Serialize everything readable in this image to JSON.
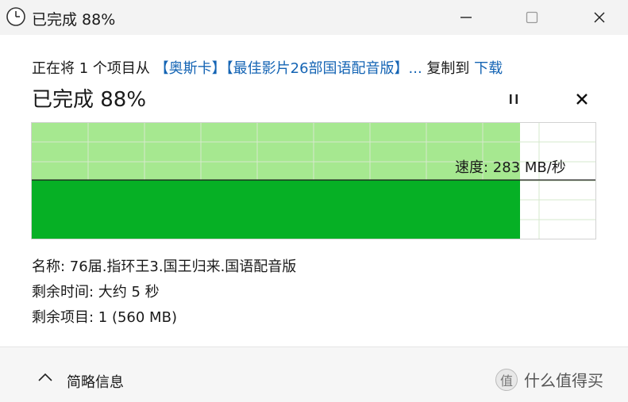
{
  "window": {
    "title": "已完成 88%",
    "icons": {
      "app": "clock-icon",
      "minimize": "minimize-icon",
      "maximize": "maximize-icon",
      "close": "close-icon"
    }
  },
  "transfer": {
    "prefix": "正在将 1 个项目从 ",
    "source": "【奥斯卡】【最佳影片26部国语配音版】...",
    "middle": " 复制到 ",
    "destination": "下载",
    "status": "已完成 88%",
    "percent_complete": 88
  },
  "controls": {
    "pause_icon": "pause-icon",
    "stop_icon": "stop-icon"
  },
  "graph": {
    "speed_text": "速度: 283 MB/秒",
    "progress_fraction": 0.88,
    "colors": {
      "light": "#a6e890",
      "dark": "#06b025",
      "grid": "#d8eccf"
    }
  },
  "details": {
    "name": "名称: 76届.指环王3.国王归来.国语配音版",
    "time_remaining": "剩余时间: 大约 5 秒",
    "items_remaining": "剩余项目: 1 (560 MB)"
  },
  "footer": {
    "details_label": "简略信息",
    "watermark_text": "什么值得买",
    "watermark_badge": "值"
  }
}
